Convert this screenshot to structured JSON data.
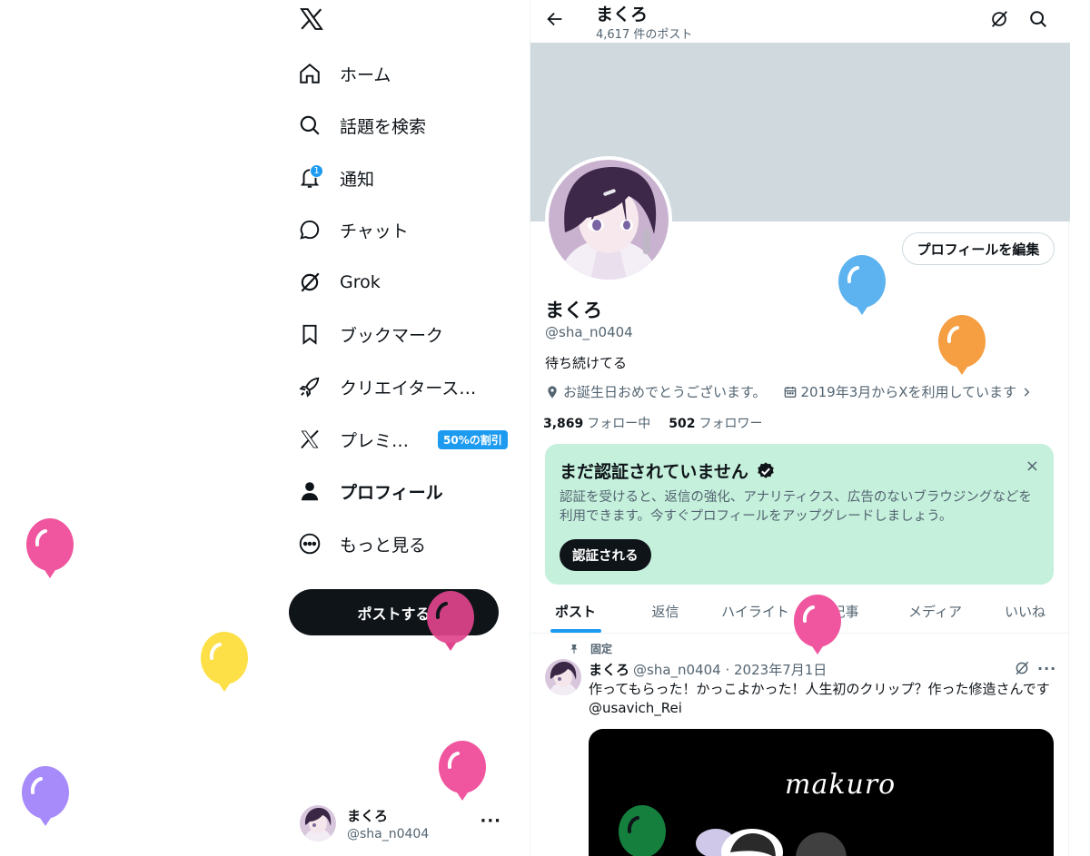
{
  "nav": {
    "items": [
      {
        "label": "ホーム",
        "icon": "home-icon"
      },
      {
        "label": "話題を検索",
        "icon": "search-icon"
      },
      {
        "label": "通知",
        "icon": "bell-icon",
        "badge": "1"
      },
      {
        "label": "チャット",
        "icon": "chat-icon"
      },
      {
        "label": "Grok",
        "icon": "grok-icon"
      },
      {
        "label": "ブックマーク",
        "icon": "bookmark-icon"
      },
      {
        "label": "クリエイタース…",
        "icon": "rocket-icon"
      },
      {
        "label": "プレミ…",
        "icon": "x-logo-icon",
        "promo": "50%の割引"
      },
      {
        "label": "プロフィール",
        "icon": "person-icon",
        "active": true
      },
      {
        "label": "もっと見る",
        "icon": "more-circle-icon"
      }
    ],
    "post_button": "ポストする",
    "account": {
      "name": "まくろ",
      "handle": "@sha_n0404",
      "more": "···"
    }
  },
  "topbar": {
    "title": "まくろ",
    "post_count": "4,617 件のポスト"
  },
  "profile": {
    "edit_button": "プロフィールを編集",
    "name": "まくろ",
    "handle": "@sha_n0404",
    "bio": "待ち続けてる",
    "location": "お誕生日おめでとうございます。",
    "joined": "2019年3月からXを利用しています",
    "following_count": "3,869",
    "following_label": "フォロー中",
    "followers_count": "502",
    "followers_label": "フォロワー"
  },
  "verify_card": {
    "title": "まだ認証されていません",
    "close": "×",
    "body": "認証を受けると、返信の強化、アナリティクス、広告のないブラウジングなどを利用できます。今すぐプロフィールをアップグレードしましょう。",
    "button": "認証される"
  },
  "tabs": [
    "ポスト",
    "返信",
    "ハイライト",
    "記事",
    "メディア",
    "いいね"
  ],
  "active_tab": "ポスト",
  "pinned_post": {
    "pinned_label": "固定",
    "name": "まくろ",
    "handle_date": "@sha_n0404 · 2023年7月1日",
    "more": "···",
    "text": "作ってもらった！かっこよかった！人生初のクリップ？作った修造さんです @usavich_Rei",
    "media_title": "makuro"
  },
  "colors": {
    "accent": "#1d9bf0",
    "verify_bg": "#c5f0dc",
    "banner": "#cfd9de",
    "balloons": [
      "#f0569f",
      "#fde047",
      "#a78bfa",
      "#5db3ef",
      "#f59e42",
      "#f0569f",
      "#f0569f",
      "#f0569f",
      "#15803d"
    ]
  }
}
